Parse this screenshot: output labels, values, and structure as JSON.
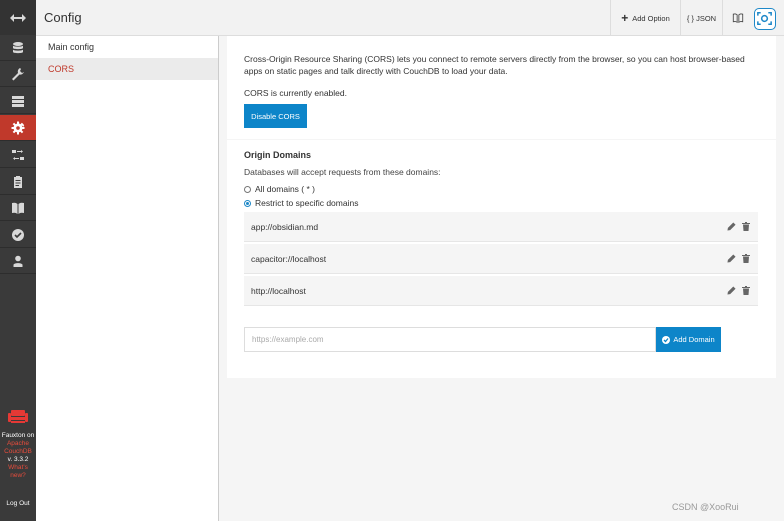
{
  "app": {
    "brand_line1": "Fauxton on",
    "brand_line2": "Apache",
    "brand_line3": "CouchDB",
    "version": "v. 3.3.2",
    "whats_new": "What's new?",
    "logout_label": "Log Out"
  },
  "rail": {
    "items": [
      {
        "icon": "database-icon"
      },
      {
        "icon": "wrench-icon"
      },
      {
        "icon": "server-icon"
      },
      {
        "icon": "gear-icon",
        "active": true
      },
      {
        "icon": "replication-icon"
      },
      {
        "icon": "clipboard-icon"
      },
      {
        "icon": "book-icon"
      },
      {
        "icon": "verify-icon"
      },
      {
        "icon": "user-icon"
      }
    ],
    "active_color": "#c0392b"
  },
  "header": {
    "title": "Config",
    "add_option_label": "Add Option",
    "json_label": "{ } JSON"
  },
  "subnav": {
    "items": [
      {
        "label": "Main config"
      },
      {
        "label": "CORS",
        "active": true
      }
    ]
  },
  "cors": {
    "intro": "Cross-Origin Resource Sharing (CORS) lets you connect to remote servers directly from the browser, so you can host browser-based apps on static pages and talk directly with CouchDB to load your data.",
    "status": "CORS is currently enabled.",
    "disable_label": "Disable CORS",
    "origins_title": "Origin Domains",
    "origins_desc": "Databases will accept requests from these domains:",
    "radio_all_label": "All domains ( * )",
    "radio_restrict_label": "Restrict to specific domains",
    "selected_option": "Restrict to specific domains",
    "domains": [
      "app://obsidian.md",
      "capacitor://localhost",
      "http://localhost"
    ],
    "input_placeholder": "https://example.com",
    "add_domain_label": "Add Domain",
    "accent_color": "#0d85c9"
  },
  "watermark": "CSDN @XooRui"
}
